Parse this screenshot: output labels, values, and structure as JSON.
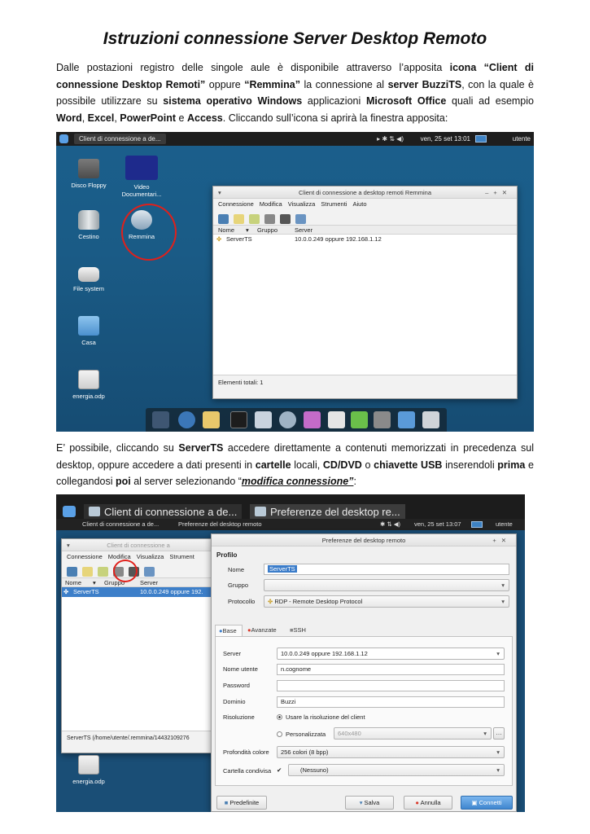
{
  "title": "Istruzioni connessione Server Desktop Remoto",
  "para1": [
    {
      "t": "Dalle postazioni registro delle singole aule è disponibile attraverso l’apposita "
    },
    {
      "t": "icona “Client di connessione Desktop Remoti”",
      "s": "b"
    },
    {
      "t": " oppure "
    },
    {
      "t": "“Remmina”",
      "s": "b"
    },
    {
      "t": " la connessione al "
    },
    {
      "t": "server BuzziTS",
      "s": "b"
    },
    {
      "t": ",  con la quale è possibile utilizzare su "
    },
    {
      "t": "sistema operativo Windows",
      "s": "b"
    },
    {
      "t": " applicazioni "
    },
    {
      "t": "Microsoft Office",
      "s": "b"
    },
    {
      "t": " quali ad esempio "
    },
    {
      "t": "Word",
      "s": "b"
    },
    {
      "t": ", "
    },
    {
      "t": "Excel",
      "s": "b"
    },
    {
      "t": ", "
    },
    {
      "t": "PowerPoint",
      "s": "b"
    },
    {
      "t": " e "
    },
    {
      "t": "Access",
      "s": "b"
    },
    {
      "t": ".        Cliccando sull’icona si aprirà la finestra apposita:"
    }
  ],
  "para2": [
    {
      "t": "E’ possibile, cliccando su "
    },
    {
      "t": "ServerTS",
      "s": "b"
    },
    {
      "t": "  accedere direttamente a contenuti memorizzati in precedenza sul desktop, oppure accedere a dati presenti in "
    },
    {
      "t": "cartelle",
      "s": "b"
    },
    {
      "t": " locali, "
    },
    {
      "t": "CD/DVD",
      "s": "b"
    },
    {
      "t": " o "
    },
    {
      "t": "chiavette USB",
      "s": "b"
    },
    {
      "t": " inserendoli "
    },
    {
      "t": "prima",
      "s": "b"
    },
    {
      "t": " e collegandosi "
    },
    {
      "t": "poi",
      "s": "b"
    },
    {
      "t": " al server selezionando “"
    },
    {
      "t": "modifica connessione”",
      "s": "lnk"
    },
    {
      "t": ":"
    }
  ],
  "shot1": {
    "taskbar_task": "Client di connessione a de...",
    "clock": "ven, 25 set  13:01",
    "user": "utente",
    "desktop_icons": {
      "floppy": "Disco Floppy",
      "video": "Video Documentari...",
      "trash": "Cestino",
      "remmina": "Remmina",
      "filesystem": "File system",
      "home": "Casa",
      "energia": "energia.odp"
    },
    "window": {
      "title": "Client di connessione a desktop remoti Remmina",
      "menu": [
        "Connessione",
        "Modifica",
        "Visualizza",
        "Strumenti",
        "Aiuto"
      ],
      "col_nome": "Nome",
      "col_gruppo": "Gruppo",
      "col_server": "Server",
      "row_name": "ServerTS",
      "row_server": "10.0.0.249 oppure 192.168.1.12",
      "status": "Elementi totali: 1"
    }
  },
  "shot2": {
    "task1": "Client di connessione a de...",
    "task2": "Preferenze del desktop re...",
    "small_task1": "Client di connessione a de...",
    "small_task2": "Preferenze del desktop remoto",
    "clock": "ven, 25 set  13:07",
    "user": "utente",
    "bg_window": {
      "title": "Client di connessione a",
      "menu": [
        "Connessione",
        "Modifica",
        "Visualizza",
        "Strument"
      ],
      "col_nome": "Nome",
      "col_gruppo": "Gruppo",
      "col_server": "Server",
      "row_name": "ServerTS",
      "row_server": "10.0.0.249 oppure 192.",
      "status": "ServerTS (/home/utente/.remmina/14432109276",
      "energia": "energia.odp"
    },
    "prefs": {
      "title": "Preferenze del desktop remoto",
      "section": "Profilo",
      "nome_label": "Nome",
      "nome_value": "ServerTS",
      "gruppo_label": "Gruppo",
      "protocollo_label": "Protocollo",
      "protocollo_value": "RDP - Remote Desktop Protocol",
      "tab_base": "Base",
      "tab_avanzate": "Avanzate",
      "tab_ssh": "SSH",
      "server_label": "Server",
      "server_value": "10.0.0.249 oppure 192.168.1.12",
      "utente_label": "Nome utente",
      "utente_value": "n.cognome",
      "password_label": "Password",
      "dominio_label": "Dominio",
      "dominio_value": "Buzzi",
      "risoluzione_label": "Risoluzione",
      "ris_opt1": "Usare la risoluzione del client",
      "ris_opt2": "Personalizzata",
      "ris_custom": "640x480",
      "profondita_label": "Profondità colore",
      "profondita_value": "256 colori (8 bpp)",
      "cartella_label": "Cartella condivisa",
      "cartella_value": "(Nessuno)",
      "btn_predefinite": "Predefinite",
      "btn_salva": "Salva",
      "btn_annulla": "Annulla",
      "btn_connetti": "Connetti"
    }
  }
}
